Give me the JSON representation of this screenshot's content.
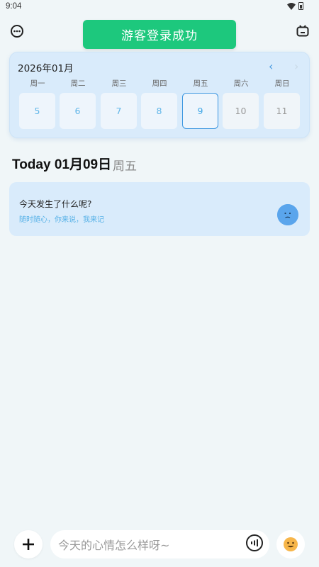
{
  "status_bar": {
    "time": "9:04"
  },
  "toast": {
    "text": "游客登录成功"
  },
  "calendar": {
    "month": "2026年01月",
    "weekdays": [
      "周一",
      "周二",
      "周三",
      "周四",
      "周五",
      "周六",
      "周日"
    ],
    "days": [
      "5",
      "6",
      "7",
      "8",
      "9",
      "10",
      "11"
    ],
    "selected_day": "9"
  },
  "today": {
    "title": "Today 01月09日",
    "weekday": "周五"
  },
  "entry": {
    "title": "今天发生了什么呢?",
    "subtitle": "随时随心，你来说，我来记"
  },
  "input": {
    "placeholder": "今天的心情怎么样呀~"
  },
  "colors": {
    "accent": "#3a95e0",
    "toast": "#1dc87d",
    "card": "#d9ebfb"
  }
}
